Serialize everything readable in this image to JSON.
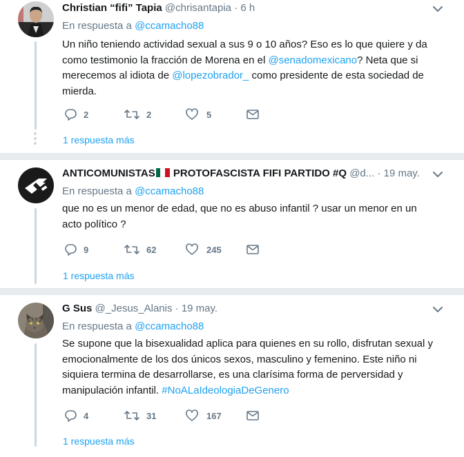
{
  "tweets": [
    {
      "name": "Christian “fifi” Tapia",
      "handle": "@chrisantapia",
      "separator": "·",
      "time": "6 h",
      "reply_prefix": "En respuesta a",
      "reply_to": "@ccamacho88",
      "text_parts": [
        "Un niño teniendo actividad sexual a sus 9 o 10 años? Eso es lo que quiere y da como testimonio la fracción de Morena en el ",
        "@senadomexicano",
        "? Neta que si merecemos al idiota de ",
        "@lopezobrador_",
        " como presidente de esta sociedad de mierda."
      ],
      "replies": "2",
      "retweets": "2",
      "likes": "5",
      "more_replies": "1 respuesta más"
    },
    {
      "name": "ANTICOMUNISTAS",
      "name_suffix": " PROTOFASCISTA FIFI PARTIDO #Q",
      "handle": "@d...",
      "separator": "·",
      "time": "19 may.",
      "reply_prefix": "En respuesta a",
      "reply_to": "@ccamacho88",
      "text": "que no es un menor de edad, que no es abuso infantil ? usar un menor en un acto político ?",
      "replies": "9",
      "retweets": "62",
      "likes": "245",
      "more_replies": "1 respuesta más"
    },
    {
      "name": "G Sus",
      "handle": "@_Jesus_Alanis",
      "separator": "·",
      "time": "19 may.",
      "reply_prefix": "En respuesta a",
      "reply_to": "@ccamacho88",
      "text_parts": [
        "Se supone que la bisexualidad aplica para quienes en su rollo, disfrutan sexual y emocionalmente de los dos únicos sexos, masculino y femenino. Este niño ni siquiera termina de desarrollarse, es una clarísima forma de perversidad y manipulación infantil. ",
        "#NoALaIdeologiaDeGenero"
      ],
      "replies": "4",
      "retweets": "31",
      "likes": "167",
      "more_replies": "1 respuesta más"
    }
  ],
  "colors": {
    "link": "#1da1f2",
    "muted": "#657786",
    "text": "#14171a",
    "thread_line": "#ccd6dd",
    "divider": "#e6ecf0"
  },
  "icons": [
    "reply-icon",
    "retweet-icon",
    "like-icon",
    "direct-message-icon",
    "chevron-down-icon"
  ]
}
